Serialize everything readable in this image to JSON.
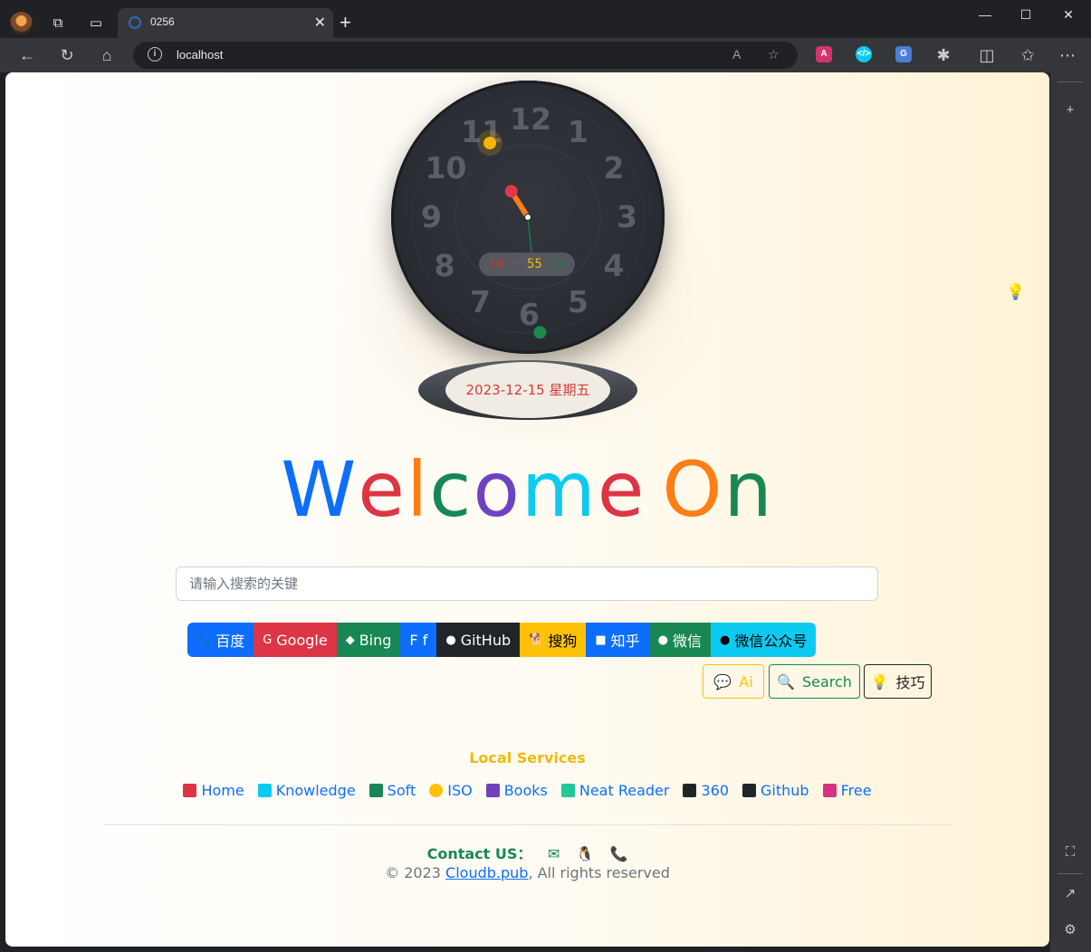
{
  "browser": {
    "tab_title": "0256",
    "url": "localhost",
    "close_tab": "✕",
    "new_tab": "+"
  },
  "clock": {
    "numbers": [
      "12",
      "1",
      "2",
      "3",
      "4",
      "5",
      "6",
      "7",
      "8",
      "9",
      "10",
      "11"
    ],
    "digital_hour": "10",
    "digital_sep": ":",
    "digital_minute": "55",
    "digital_second": "29",
    "time": {
      "hour": 10,
      "minute": 55,
      "second": 29
    },
    "date": "2023-12-15 星期五"
  },
  "welcome": {
    "letters": [
      {
        "char": "W",
        "color": "#0d6efd"
      },
      {
        "char": "e",
        "color": "#dc3545"
      },
      {
        "char": "l",
        "color": "#fd7e14"
      },
      {
        "char": "c",
        "color": "#198754"
      },
      {
        "char": "o",
        "color": "#6f42c1"
      },
      {
        "char": "m",
        "color": "#0dcaf0"
      },
      {
        "char": "e",
        "color": "#dc3545"
      },
      {
        "char": " ",
        "color": "#000000"
      },
      {
        "char": "O",
        "color": "#fd7e14"
      },
      {
        "char": "n",
        "color": "#198754"
      }
    ]
  },
  "search": {
    "placeholder": "请输入搜索的关键",
    "value": ""
  },
  "engines": [
    {
      "label": "百度",
      "icon": "paw-icon",
      "glyph": "🐾",
      "color": "#0d6efd"
    },
    {
      "label": "Google",
      "icon": "google-icon",
      "glyph": "G",
      "color": "#dc3545"
    },
    {
      "label": "Bing",
      "icon": "bing-icon",
      "glyph": "◆",
      "color": "#198754"
    },
    {
      "label": "F f",
      "icon": "",
      "glyph": "",
      "color": "#0d6efd"
    },
    {
      "label": "GitHub",
      "icon": "github-icon",
      "glyph": "●",
      "color": "#212529"
    },
    {
      "label": "搜狗",
      "icon": "dog-icon",
      "glyph": "🐕",
      "color": "#ffc107",
      "text_color": "#000000"
    },
    {
      "label": "知乎",
      "icon": "zhihu-icon",
      "glyph": "■",
      "color": "#0d6efd"
    },
    {
      "label": "微信",
      "icon": "wechat-icon",
      "glyph": "●",
      "color": "#198754"
    },
    {
      "label": "微信公众号",
      "icon": "comments-icon",
      "glyph": "●",
      "color": "#0dcaf0",
      "text_color": "#000000"
    }
  ],
  "actions": {
    "ai_label": "Ai",
    "search_label": "Search",
    "tips_label": "技巧"
  },
  "local_services": {
    "title": "Local Services",
    "links": [
      {
        "label": "Home",
        "icon": "home-icon",
        "icon_color": "#dc3545"
      },
      {
        "label": "Knowledge",
        "icon": "book-open-icon",
        "icon_color": "#0dcaf0"
      },
      {
        "label": "Soft",
        "icon": "windows-icon",
        "icon_color": "#198754"
      },
      {
        "label": "ISO",
        "icon": "disc-icon",
        "icon_color": "#ffc107"
      },
      {
        "label": "Books",
        "icon": "books-icon",
        "icon_color": "#6f42c1"
      },
      {
        "label": "Neat Reader",
        "icon": "cube-icon",
        "icon_color": "#20c997"
      },
      {
        "label": "360",
        "icon": "ie-icon",
        "icon_color": "#212529"
      },
      {
        "label": "Github",
        "icon": "github-square-icon",
        "icon_color": "#212529"
      },
      {
        "label": "Free",
        "icon": "grid-icon",
        "icon_color": "#d63384"
      }
    ]
  },
  "footer": {
    "contact_label": "Contact US：",
    "copyright_prefix": "© 2023 ",
    "copyright_link": "Cloudb.pub",
    "copyright_suffix": ", All rights reserved"
  }
}
